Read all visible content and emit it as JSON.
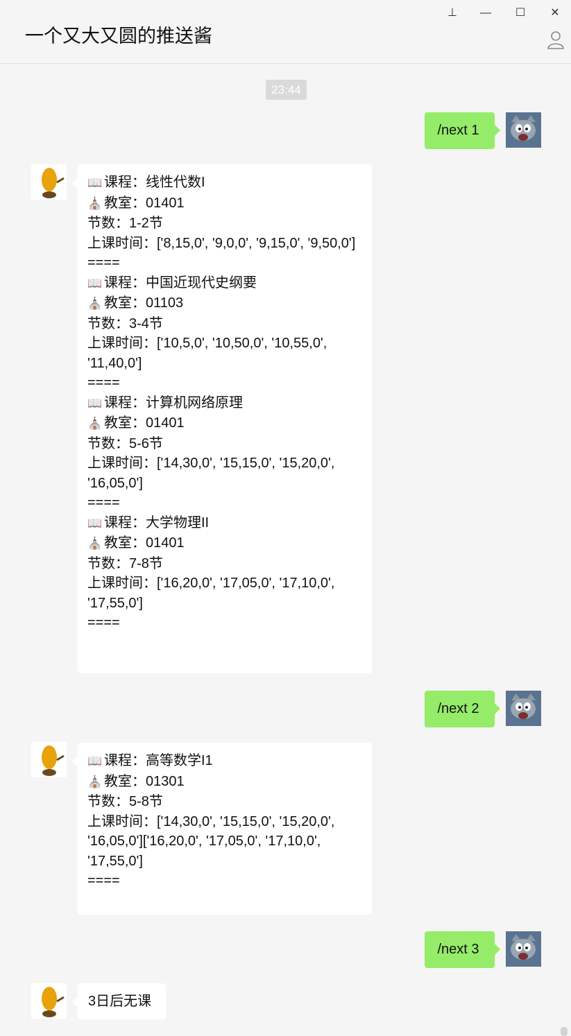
{
  "window": {
    "title": "一个又大又圆的推送酱",
    "controls": {
      "pin": "⊥",
      "minimize": "—",
      "maximize": "☐",
      "close": "✕"
    }
  },
  "chat": {
    "time_badge": "23:44",
    "messages": [
      {
        "side": "right",
        "text": "/next 1"
      },
      {
        "side": "left",
        "lines": [
          {
            "icon": "📖",
            "text": "课程：线性代数I"
          },
          {
            "icon": "⛪",
            "text": "教室：01401"
          },
          {
            "text": "节数：1-2节"
          },
          {
            "text": "上课时间：['8,15,0', '9,0,0', '9,15,0', '9,50,0']"
          },
          {
            "text": "===="
          },
          {
            "icon": "📖",
            "text": "课程：中国近现代史纲要"
          },
          {
            "icon": "⛪",
            "text": "教室：01103"
          },
          {
            "text": "节数：3-4节"
          },
          {
            "text": "上课时间：['10,5,0', '10,50,0', '10,55,0', '11,40,0']"
          },
          {
            "text": "===="
          },
          {
            "icon": "📖",
            "text": "课程：计算机网络原理"
          },
          {
            "icon": "⛪",
            "text": "教室：01401"
          },
          {
            "text": "节数：5-6节"
          },
          {
            "text": "上课时间：['14,30,0', '15,15,0', '15,20,0', '16,05,0']"
          },
          {
            "text": "===="
          },
          {
            "icon": "📖",
            "text": "课程：大学物理II"
          },
          {
            "icon": "⛪",
            "text": "教室：01401"
          },
          {
            "text": "节数：7-8节"
          },
          {
            "text": "上课时间：['16,20,0', '17,05,0', '17,10,0', '17,55,0']"
          },
          {
            "text": "===="
          }
        ]
      },
      {
        "side": "right",
        "text": "/next 2"
      },
      {
        "side": "left",
        "lines": [
          {
            "icon": "📖",
            "text": "课程：高等数学I1"
          },
          {
            "icon": "⛪",
            "text": "教室：01301"
          },
          {
            "text": "节数：5-8节"
          },
          {
            "text": "上课时间：['14,30,0', '15,15,0', '15,20,0', '16,05,0']['16,20,0', '17,05,0', '17,10,0', '17,55,0']"
          },
          {
            "text": "===="
          }
        ]
      },
      {
        "side": "right",
        "text": "/next 3"
      },
      {
        "side": "left",
        "text": "3日后无课"
      }
    ]
  },
  "colors": {
    "background": "#f5f5f5",
    "sent_bubble": "#95ec69",
    "received_bubble": "#ffffff",
    "time_badge_bg": "#dadada"
  }
}
